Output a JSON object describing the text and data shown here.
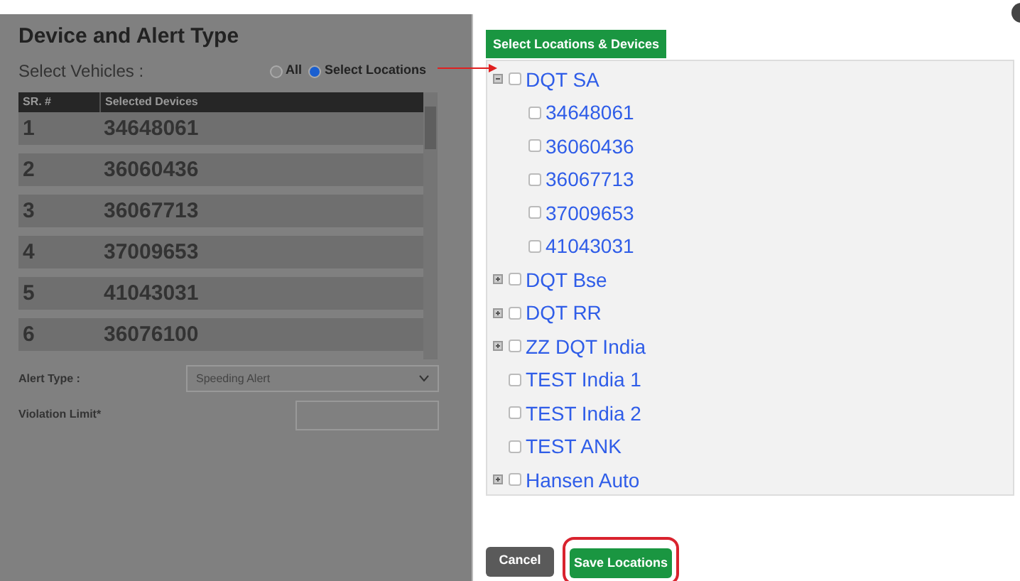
{
  "background_panel": {
    "title": "Device and Alert Type",
    "select_vehicles_label": "Select Vehicles :",
    "vehicle_options": [
      {
        "label": "All",
        "selected": false
      },
      {
        "label": "Select Locations",
        "selected": true
      }
    ],
    "table": {
      "columns": [
        "SR. #",
        "Selected Devices"
      ],
      "rows": [
        [
          "1",
          "34648061"
        ],
        [
          "2",
          "36060436"
        ],
        [
          "3",
          "36067713"
        ],
        [
          "4",
          "37009653"
        ],
        [
          "5",
          "41043031"
        ],
        [
          "6",
          "36076100"
        ]
      ]
    },
    "alert_type_label": "Alert Type :",
    "alert_type_value": "Speeding Alert",
    "violation_limit_label": "Violation Limit*"
  },
  "dialog": {
    "header": "Select Locations & Devices",
    "tree": [
      {
        "kind": "group",
        "label": "DQT SA",
        "expanded": true,
        "checked": false,
        "children": [
          {
            "label": "34648061",
            "checked": false
          },
          {
            "label": "36060436",
            "checked": false
          },
          {
            "label": "36067713",
            "checked": false
          },
          {
            "label": "37009653",
            "checked": false
          },
          {
            "label": "41043031",
            "checked": false
          }
        ]
      },
      {
        "kind": "group",
        "label": "DQT Bse",
        "expanded": false,
        "checked": false
      },
      {
        "kind": "group",
        "label": "DQT RR",
        "expanded": false,
        "checked": false
      },
      {
        "kind": "group",
        "label": "ZZ DQT India",
        "expanded": false,
        "checked": false
      },
      {
        "kind": "leaf",
        "label": "TEST India 1",
        "checked": false
      },
      {
        "kind": "leaf",
        "label": "TEST India 2",
        "checked": false
      },
      {
        "kind": "leaf",
        "label": "TEST ANK",
        "checked": false
      },
      {
        "kind": "group",
        "label": "Hansen Auto",
        "expanded": false,
        "checked": false
      }
    ],
    "buttons": [
      {
        "kind": "cancel",
        "label": "Cancel"
      },
      {
        "kind": "save",
        "label": "Save Locations",
        "highlighted": true
      }
    ]
  }
}
